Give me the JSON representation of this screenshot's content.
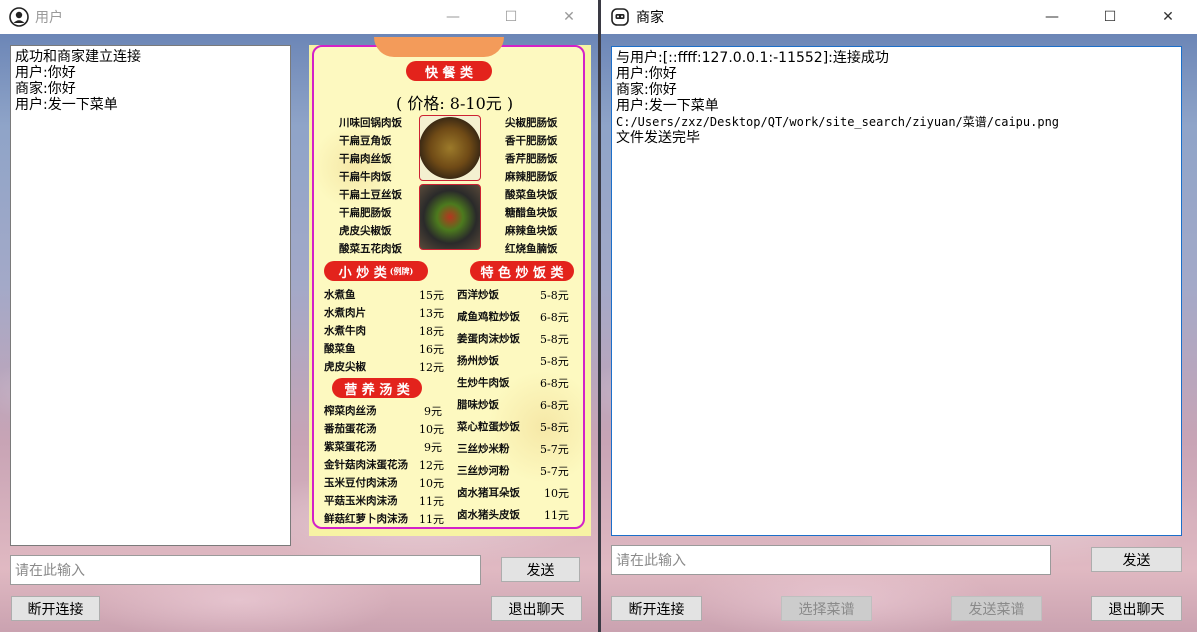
{
  "left_window": {
    "title": "用户",
    "controls": {
      "minimize": "—",
      "maximize": "☐",
      "close": "✕"
    },
    "chat_lines": [
      "成功和商家建立连接",
      "用户:你好",
      "商家:你好",
      "用户:发一下菜单"
    ],
    "input_placeholder": "请在此输入",
    "send_label": "发送",
    "disconnect_label": "断开连接",
    "exit_label": "退出聊天"
  },
  "right_window": {
    "title": "商家",
    "controls": {
      "minimize": "—",
      "maximize": "☐",
      "close": "✕"
    },
    "chat_lines": [
      "与用户:[::ffff:127.0.0.1:-11552]:连接成功",
      "用户:你好",
      "商家:你好",
      "用户:发一下菜单",
      "C:/Users/zxz/Desktop/QT/work/site_search/ziyuan/菜谱/caipu.png",
      "文件发送完毕"
    ],
    "input_placeholder": "请在此输入",
    "send_label": "发送",
    "disconnect_label": "断开连接",
    "select_menu_label": "选择菜谱",
    "send_menu_label": "发送菜谱",
    "exit_label": "退出聊天"
  },
  "menu_image": {
    "fast_food_title": "快 餐 类",
    "price_range": "( 价格: 8-10元 )",
    "fast_food_left": [
      "川味回锅肉饭",
      "干扁豆角饭",
      "干扁肉丝饭",
      "干扁牛肉饭",
      "干扁土豆丝饭",
      "干扁肥肠饭",
      "虎皮尖椒饭",
      "酸菜五花肉饭"
    ],
    "fast_food_right": [
      "尖椒肥肠饭",
      "香干肥肠饭",
      "香芹肥肠饭",
      "麻辣肥肠饭",
      "酸菜鱼块饭",
      "糖醋鱼块饭",
      "麻辣鱼块饭",
      "红烧鱼腩饭"
    ],
    "stir_fry_title": "小 炒 类",
    "stir_fry_note": "(例牌)",
    "stir_fry": [
      {
        "name": "水煮鱼",
        "price": "15元"
      },
      {
        "name": "水煮肉片",
        "price": "13元"
      },
      {
        "name": "水煮牛肉",
        "price": "18元"
      },
      {
        "name": "酸菜鱼",
        "price": "16元"
      },
      {
        "name": "虎皮尖椒",
        "price": "12元"
      }
    ],
    "soup_title": "营 养 汤 类",
    "soups": [
      {
        "name": "榨菜肉丝汤",
        "price": "9元"
      },
      {
        "name": "番茄蛋花汤",
        "price": "10元"
      },
      {
        "name": "紫菜蛋花汤",
        "price": "9元"
      },
      {
        "name": "金针菇肉沫蛋花汤",
        "price": "12元"
      },
      {
        "name": "玉米豆付肉沫汤",
        "price": "10元"
      },
      {
        "name": "平菇玉米肉沫汤",
        "price": "11元"
      },
      {
        "name": "鲜菇红萝卜肉沫汤",
        "price": "11元"
      }
    ],
    "fried_rice_title": "特 色 炒 饭 类",
    "fried_rice": [
      {
        "name": "西洋炒饭",
        "price": "5-8元"
      },
      {
        "name": "咸鱼鸡粒炒饭",
        "price": "6-8元"
      },
      {
        "name": "姜蛋肉沫炒饭",
        "price": "5-8元"
      },
      {
        "name": "扬州炒饭",
        "price": "5-8元"
      },
      {
        "name": "生炒牛肉饭",
        "price": "6-8元"
      },
      {
        "name": "腊味炒饭",
        "price": "6-8元"
      },
      {
        "name": "菜心粒蛋炒饭",
        "price": "5-8元"
      },
      {
        "name": "三丝炒米粉",
        "price": "5-7元"
      },
      {
        "name": "三丝炒河粉",
        "price": "5-7元"
      },
      {
        "name": "卤水猪耳朵饭",
        "price": "10元"
      },
      {
        "name": "卤水猪头皮饭",
        "price": "11元"
      }
    ]
  },
  "colors": {
    "title_bg": "#ffffff",
    "focus_border": "#1c6fc9",
    "menu_bg": "#fdf9c0",
    "menu_border": "#d421c8",
    "menu_banner": "#e3231c"
  }
}
